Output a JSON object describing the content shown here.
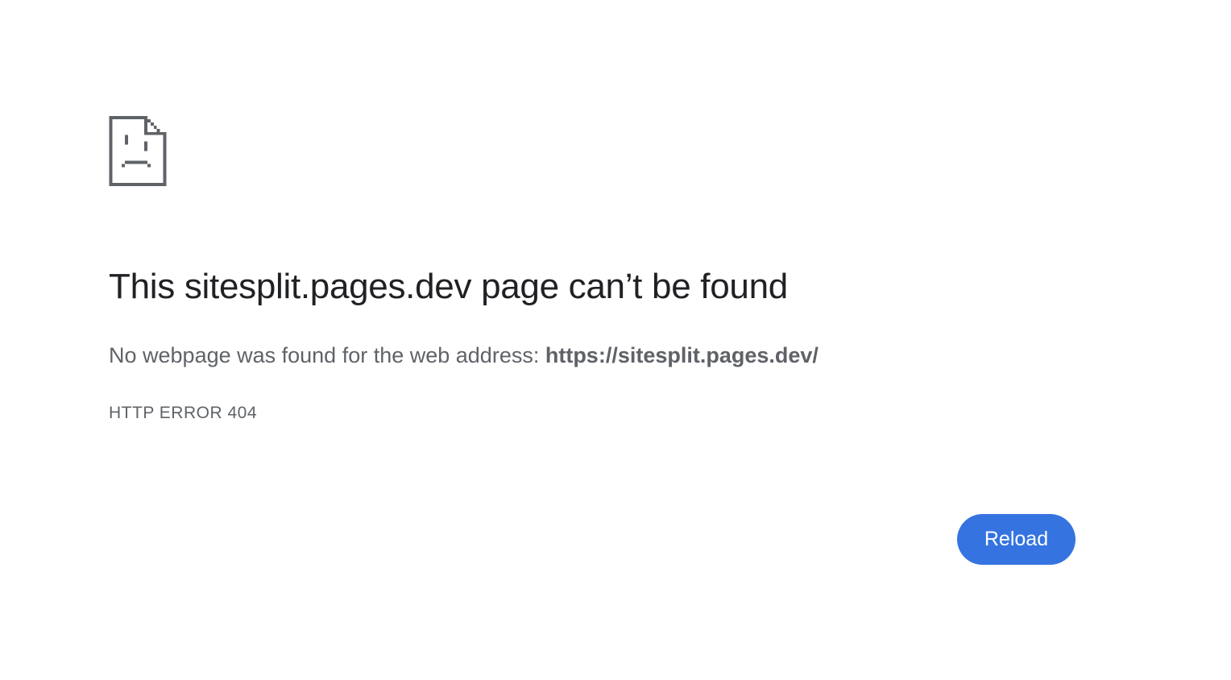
{
  "error_page": {
    "icon": "sad-page-icon",
    "heading": "This sitesplit.pages.dev page can’t be found",
    "message_prefix": "No webpage was found for the web address: ",
    "url": "https://sitesplit.pages.dev/",
    "error_code": "HTTP ERROR 404",
    "reload_label": "Reload"
  },
  "colors": {
    "heading": "#202124",
    "text": "#5f6368",
    "icon": "#5f6368",
    "button": "#3574e0",
    "button_text": "#ffffff",
    "background": "#ffffff"
  }
}
